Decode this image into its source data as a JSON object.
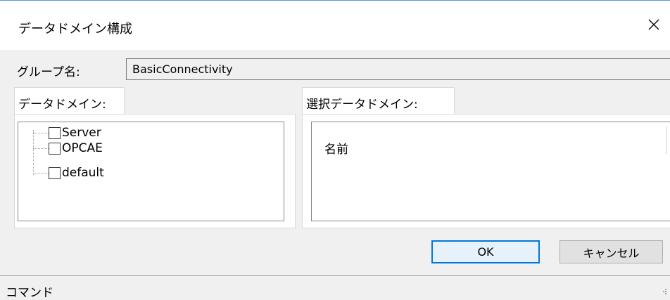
{
  "window": {
    "title": "データドメイン構成",
    "close_icon": "close-icon"
  },
  "group": {
    "label": "グループ名:",
    "value": "BasicConnectivity"
  },
  "left_tab": {
    "label": "データドメイン:",
    "items": [
      {
        "label": "Server",
        "checked": false
      },
      {
        "label": "OPCAE",
        "checked": false
      },
      {
        "label": "default",
        "checked": false
      }
    ]
  },
  "right_tab": {
    "label": "選択データドメイン:",
    "column_header": "名前"
  },
  "buttons": {
    "ok": "OK",
    "cancel": "キャンセル"
  },
  "statusbar": {
    "label": "コマンド"
  }
}
